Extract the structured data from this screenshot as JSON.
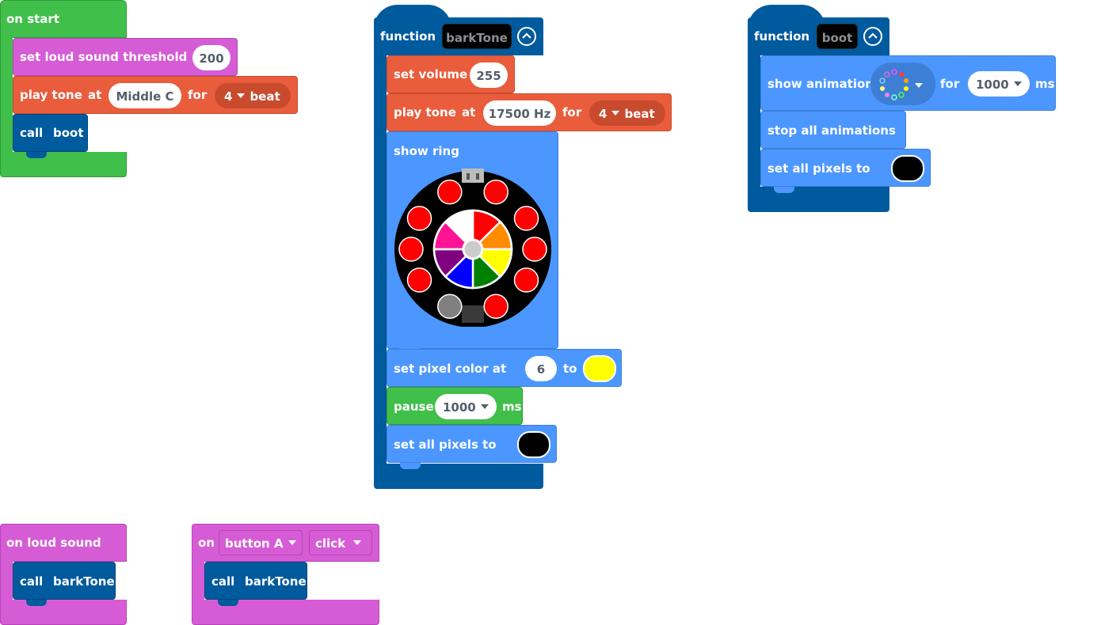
{
  "on_start": {
    "header": "on start",
    "set_threshold": {
      "label": "set loud sound threshold",
      "value": "200"
    },
    "play_tone": {
      "label": "play tone",
      "at": "at",
      "note": "Middle C",
      "for": "for",
      "beats": "4",
      "beat": "beat"
    },
    "call": {
      "label": "call",
      "target": "boot"
    }
  },
  "barktone_fn": {
    "keyword": "function",
    "name": "barkTone",
    "set_volume": {
      "label": "set volume",
      "value": "255"
    },
    "play_tone": {
      "label": "play tone",
      "at": "at",
      "freq": "17500 Hz",
      "for": "for",
      "beats": "4",
      "beat": "beat"
    },
    "show_ring": {
      "label": "show ring",
      "ring_colors": [
        "#ff0000",
        "#ff0000",
        "#ff0000",
        "#ff0000",
        "#ff0000",
        "#808080",
        "#ff0000",
        "#ff0000",
        "#ff0000",
        "#ff0000"
      ],
      "wheel_colors": [
        "#ff0000",
        "#ff8c00",
        "#ffff00",
        "#008000",
        "#0000ff",
        "#800080",
        "#ff1493",
        "#ffffff"
      ]
    },
    "set_pixel": {
      "label": "set pixel color at",
      "index": "6",
      "to": "to",
      "color": "#ffff00"
    },
    "pause": {
      "label": "pause",
      "value": "1000",
      "unit": "ms"
    },
    "set_all": {
      "label": "set all pixels to",
      "color": "#000000"
    }
  },
  "boot_fn": {
    "keyword": "function",
    "name": "boot",
    "show_animation": {
      "label": "show animation",
      "for": "for",
      "value": "1000",
      "unit": "ms"
    },
    "stop_all": {
      "label": "stop all animations"
    },
    "set_all": {
      "label": "set all pixels to",
      "color": "#000000"
    }
  },
  "on_loud": {
    "header": "on loud sound",
    "call": {
      "label": "call",
      "target": "barkTone"
    }
  },
  "on_button": {
    "on": "on",
    "button": "button A",
    "event": "click",
    "call": {
      "label": "call",
      "target": "barkTone"
    }
  },
  "colors": {
    "loops_green": "#40bf4a",
    "input_magenta": "#d65cd6",
    "music_orange": "#e95d3d",
    "functions_blue": "#005a9e",
    "light_blue": "#4c97ff",
    "pause_green": "#40bf4a"
  }
}
